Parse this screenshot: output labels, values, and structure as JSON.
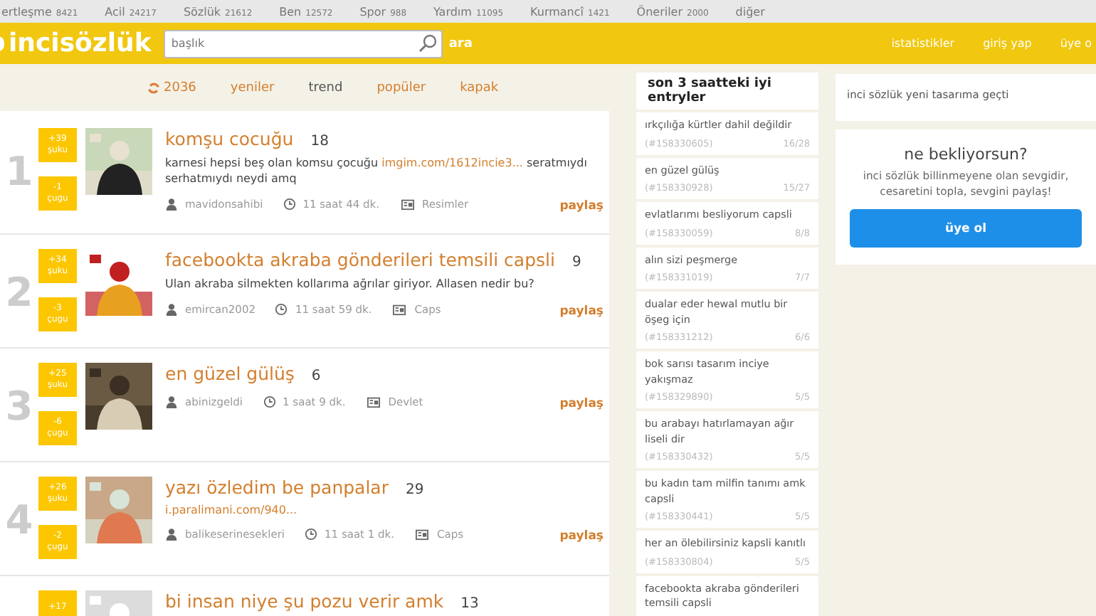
{
  "top_links": [
    {
      "label": "ertleşme",
      "count": "8421"
    },
    {
      "label": "Acil",
      "count": "24217"
    },
    {
      "label": "Sözlük",
      "count": "21612"
    },
    {
      "label": "Ben",
      "count": "12572"
    },
    {
      "label": "Spor",
      "count": "988"
    },
    {
      "label": "Yardım",
      "count": "11095"
    },
    {
      "label": "Kurmancî",
      "count": "1421"
    },
    {
      "label": "Öneriler",
      "count": "2000"
    },
    {
      "label": "diğer"
    }
  ],
  "header": {
    "logo": "incisözlük",
    "search_placeholder": "başlık",
    "search_button": "ara",
    "links": [
      "istatistikler",
      "giriş yap",
      "üye o"
    ]
  },
  "tabs": {
    "refresh_count": "2036",
    "items": [
      {
        "label": "yeniler",
        "selected": false
      },
      {
        "label": "trend",
        "selected": true
      },
      {
        "label": "popüler",
        "selected": false
      },
      {
        "label": "kapak",
        "selected": false
      }
    ]
  },
  "entries": [
    {
      "rank": "1",
      "up": "+39",
      "up_label": "şuku",
      "down": "-1",
      "down_label": "çugu",
      "title": "komşu cocuğu",
      "count": "18",
      "text": "karnesi hepsi beş olan komsu çocuğu",
      "link": "imgim.com/1612incie3...",
      "text_after": "seratmıydı serhatmıydı neydi amq",
      "author": "mavidonsahibi",
      "time": "11 saat 44 dk.",
      "channel": "Resimler",
      "share": "paylaş"
    },
    {
      "rank": "2",
      "up": "+34",
      "up_label": "şuku",
      "down": "-3",
      "down_label": "çugu",
      "title": "facebookta akraba gönderileri temsili capsli",
      "count": "9",
      "text": "Ulan akraba silmekten kollarıma ağrılar giriyor. Allasen nedir bu?",
      "author": "emircan2002",
      "time": "11 saat 59 dk.",
      "channel": "Caps",
      "share": "paylaş"
    },
    {
      "rank": "3",
      "up": "+25",
      "up_label": "şuku",
      "down": "-6",
      "down_label": "çugu",
      "title": "en güzel gülüş",
      "count": "6",
      "author": "abinizgeldi",
      "time": "1 saat 9 dk.",
      "channel": "Devlet",
      "share": "paylaş"
    },
    {
      "rank": "4",
      "up": "+26",
      "up_label": "şuku",
      "down": "-2",
      "down_label": "çugu",
      "title": "yazı özledim be panpalar",
      "count": "29",
      "link": "i.paralimani.com/940...",
      "author": "balikeserinesekleri",
      "time": "11 saat 1 dk.",
      "channel": "Caps",
      "share": "paylaş"
    },
    {
      "up": "+17",
      "title": "bi insan niye şu pozu verir amk",
      "count": "13"
    }
  ],
  "sidebar": {
    "title": "son 3 saatteki iyi entryler",
    "items": [
      {
        "title": "ırkçılığa kürtler dahil değildir",
        "id": "(#158330605)",
        "score": "16/28"
      },
      {
        "title": "en güzel gülüş",
        "id": "(#158330928)",
        "score": "15/27"
      },
      {
        "title": "evlatlarımı besliyorum capsli",
        "id": "(#158330059)",
        "score": "8/8"
      },
      {
        "title": "alın sizi peşmerge",
        "id": "(#158331019)",
        "score": "7/7"
      },
      {
        "title": "dualar eder hewal mutlu bir öşeg için",
        "id": "(#158331212)",
        "score": "6/6"
      },
      {
        "title": "bok sarısı tasarım inciye yakışmaz",
        "id": "(#158329890)",
        "score": "5/5"
      },
      {
        "title": "bu arabayı hatırlamayan ağır liseli dir",
        "id": "(#158330432)",
        "score": "5/5"
      },
      {
        "title": "bu kadın tam milfin tanımı amk capsli",
        "id": "(#158330441)",
        "score": "5/5"
      },
      {
        "title": "her an ölebilirsiniz kapsli kanıtlı",
        "id": "(#158330804)",
        "score": "5/5"
      },
      {
        "title": "facebookta akraba gönderileri temsili capsli"
      }
    ]
  },
  "notice": "inci sözlük yeni tasarıma geçti",
  "signup": {
    "title": "ne bekliyorsun?",
    "text": "inci sözlük billinmeyene olan sevgidir, cesaretini topla, sevgini paylaş!",
    "button": "üye ol"
  }
}
